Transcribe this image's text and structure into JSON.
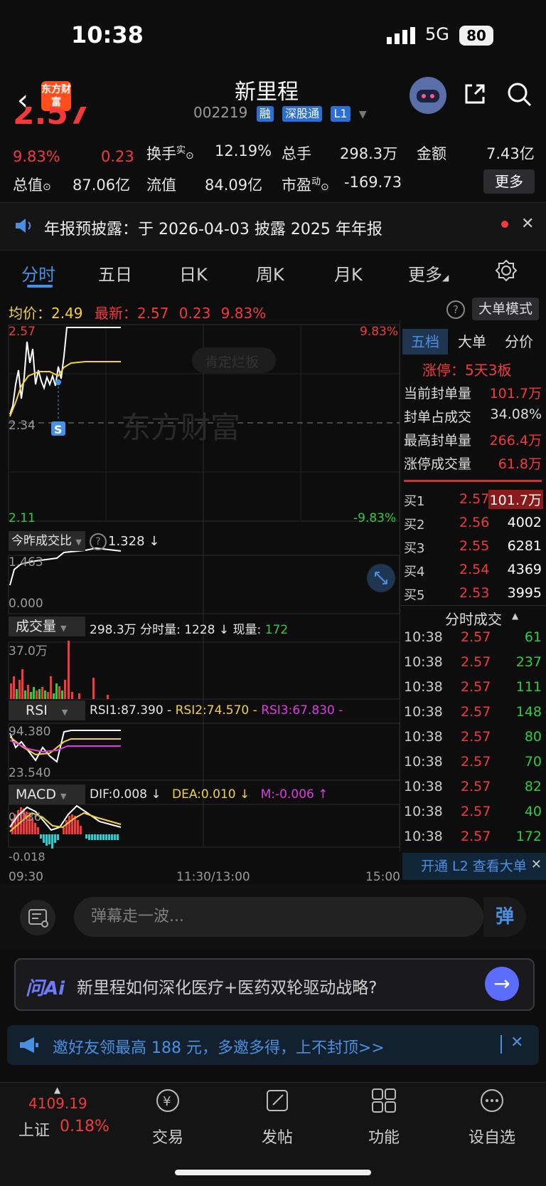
{
  "status": {
    "time": "10:38",
    "network": "5G",
    "battery": "80"
  },
  "header": {
    "logo_text": "东方财富",
    "name": "新里程",
    "code": "002219",
    "tags": [
      "融",
      "深股通",
      "L1"
    ]
  },
  "quote": {
    "price": "2.57",
    "pct": "9.83%",
    "change": "0.23",
    "turnover_label": "换手",
    "turnover_sup": "实",
    "turnover": "12.19%",
    "total_hands_label": "总手",
    "total_hands": "298.3万",
    "amount_label": "金额",
    "amount": "7.43亿",
    "mcap_label": "总值",
    "mcap": "87.06亿",
    "float_label": "流值",
    "float": "84.09亿",
    "pe_label": "市盈",
    "pe_sup": "动",
    "pe": "-169.73",
    "more": "更多"
  },
  "notice": {
    "text": "年报预披露：于 2026-04-03 披露 2025 年年报"
  },
  "tabs": [
    "分时",
    "五日",
    "日K",
    "周K",
    "月K",
    "更多"
  ],
  "info": {
    "avg_label": "均价：",
    "avg": "2.49",
    "latest_label": "最新：",
    "latest": "2.57",
    "chg": "0.23",
    "pct": "9.83%",
    "big_mode": "大单模式"
  },
  "main_chart": {
    "y_top": "2.57",
    "y_mid": "2.34",
    "y_bottom": "2.11",
    "pct_top": "9.83%",
    "pct_bottom": "-9.83%",
    "watermark": "东方财富",
    "badge": "肯定烂板",
    "sell_marker": "S"
  },
  "ratio": {
    "label": "今昨成交比",
    "value": "1.328 ↓",
    "y_top": "1.463",
    "y_bottom": "0.000"
  },
  "volume": {
    "label": "成交量",
    "total": "298.3万",
    "tick_label": "分时量:",
    "tick": "1228 ↓",
    "now_label": "现量:",
    "now": "172",
    "y_top": "37.0万"
  },
  "rsi": {
    "label": "RSI",
    "rsi1": "RSI1:87.390 -",
    "rsi2": "RSI2:74.570 -",
    "rsi3": "RSI3:67.830 -",
    "y_top": "94.380",
    "y_bottom": "23.540"
  },
  "macd": {
    "label": "MACD",
    "dif": "DIF:0.008 ↓",
    "dea": "DEA:0.010 ↓",
    "m": "M:-0.006 ↑",
    "y_top": "0.036",
    "y_bottom": "-0.018"
  },
  "time_axis": [
    "09:30",
    "11:30/13:00",
    "15:00"
  ],
  "right_panel": {
    "tabs": [
      "五档",
      "大单",
      "分价"
    ],
    "limit_up": "涨停：5天3板",
    "seal_rows": [
      {
        "label": "当前封单量",
        "value": "101.7万"
      },
      {
        "label": "封单占成交",
        "value": "34.08%"
      },
      {
        "label": "最高封单量",
        "value": "266.4万"
      },
      {
        "label": "涨停成交量",
        "value": "61.8万"
      }
    ],
    "bids": [
      {
        "label": "买1",
        "price": "2.57",
        "vol": "101.7万"
      },
      {
        "label": "买2",
        "price": "2.56",
        "vol": "4002"
      },
      {
        "label": "买3",
        "price": "2.55",
        "vol": "6281"
      },
      {
        "label": "买4",
        "price": "2.54",
        "vol": "4369"
      },
      {
        "label": "买5",
        "price": "2.53",
        "vol": "3995"
      }
    ],
    "ticks_title": "分时成交",
    "ticks": [
      {
        "time": "10:38",
        "price": "2.57",
        "vol": "61"
      },
      {
        "time": "10:38",
        "price": "2.57",
        "vol": "237"
      },
      {
        "time": "10:38",
        "price": "2.57",
        "vol": "111"
      },
      {
        "time": "10:38",
        "price": "2.57",
        "vol": "148"
      },
      {
        "time": "10:38",
        "price": "2.57",
        "vol": "80"
      },
      {
        "time": "10:38",
        "price": "2.57",
        "vol": "70"
      },
      {
        "time": "10:38",
        "price": "2.57",
        "vol": "82"
      },
      {
        "time": "10:38",
        "price": "2.57",
        "vol": "40"
      },
      {
        "time": "10:38",
        "price": "2.57",
        "vol": "172"
      }
    ],
    "l2": "开通 L2 查看大单"
  },
  "danmu": {
    "placeholder": "弹幕走一波...",
    "btn": "弹"
  },
  "ai": {
    "logo": "问Ai",
    "question": "新里程如何深化医疗+医药双轮驱动战略?"
  },
  "invite": {
    "text": "邀好友领最高 188 元，多邀多得，上不封顶>>"
  },
  "bottom": {
    "index_value": "4109.19",
    "index_name": "上证",
    "index_pct": "0.18%",
    "items": [
      "交易",
      "发帖",
      "功能",
      "设自选"
    ]
  }
}
